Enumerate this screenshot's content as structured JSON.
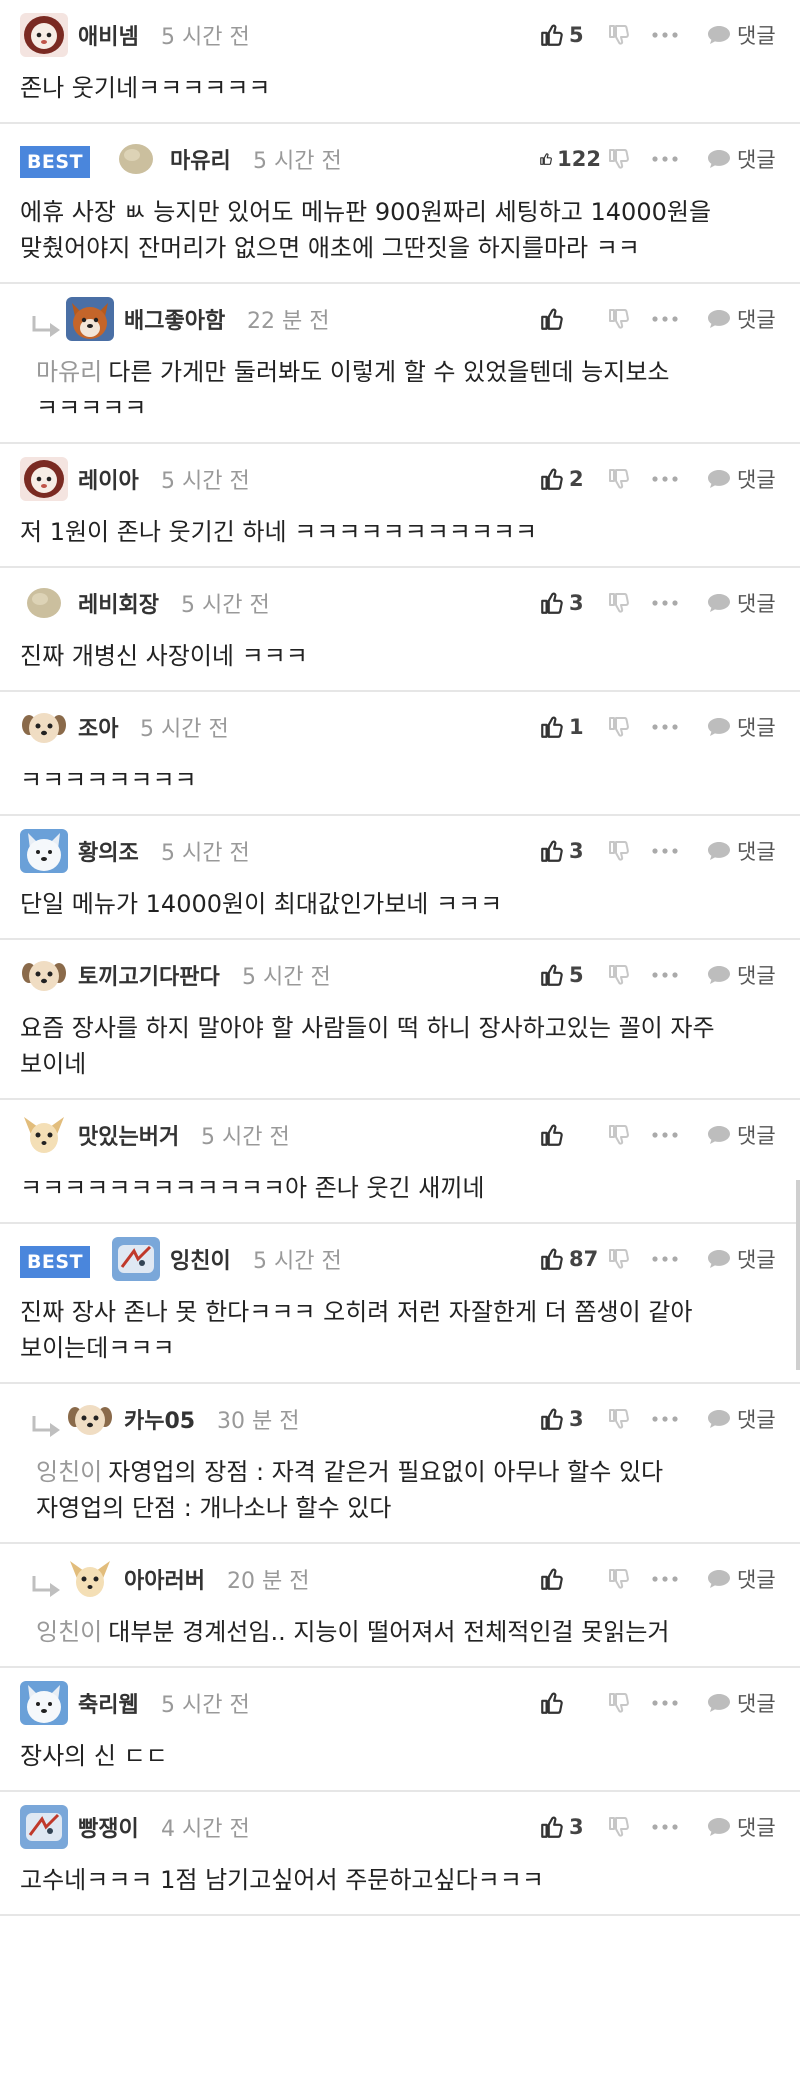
{
  "ui": {
    "reply_label": "댓글",
    "best_label": "BEST",
    "colors": {
      "best": "#4a86dc",
      "name": "#333333",
      "time": "#999999",
      "icon": "#555555"
    }
  },
  "comments": [
    {
      "name": "애비넴",
      "time": "5 시간 전",
      "likes": "5",
      "best": false,
      "reply": false,
      "avatar": "doll",
      "mention": "",
      "text": "존나 웃기네ㅋㅋㅋㅋㅋㅋ"
    },
    {
      "name": "마유리",
      "time": "5 시간 전",
      "likes": "122",
      "best": true,
      "reply": false,
      "avatar": "round",
      "mention": "",
      "text": "에휴 사장 ㅄ 능지만 있어도 메뉴판 900원짜리 세팅하고 14000원을 맞췄어야지 잔머리가 없으면 애초에 그딴짓을 하지를마라 ㅋㅋ"
    },
    {
      "name": "배그좋아함",
      "time": "22 분 전",
      "likes": "",
      "best": false,
      "reply": true,
      "avatar": "shiba",
      "mention": "마유리",
      "text": "다른 가게만 둘러봐도 이렇게 할 수 있었을텐데 능지보소 ㅋㅋㅋㅋㅋ"
    },
    {
      "name": "레이아",
      "time": "5 시간 전",
      "likes": "2",
      "best": false,
      "reply": false,
      "avatar": "doll",
      "mention": "",
      "text": "저 1원이 존나 웃기긴 하네 ㅋㅋㅋㅋㅋㅋㅋㅋㅋㅋㅋ"
    },
    {
      "name": "레비회장",
      "time": "5 시간 전",
      "likes": "3",
      "best": false,
      "reply": false,
      "avatar": "round",
      "mention": "",
      "text": "진짜 개병신 사장이네 ㅋㅋㅋ"
    },
    {
      "name": "조아",
      "time": "5 시간 전",
      "likes": "1",
      "best": false,
      "reply": false,
      "avatar": "puppy",
      "mention": "",
      "text": "ㅋㅋㅋㅋㅋㅋㅋㅋ"
    },
    {
      "name": "황의조",
      "time": "5 시간 전",
      "likes": "3",
      "best": false,
      "reply": false,
      "avatar": "husky",
      "mention": "",
      "text": "단일 메뉴가 14000원이 최대값인가보네 ㅋㅋㅋ"
    },
    {
      "name": "토끼고기다판다",
      "time": "5 시간 전",
      "likes": "5",
      "best": false,
      "reply": false,
      "avatar": "puppy",
      "mention": "",
      "text": "요즘 장사를 하지 말아야 할 사람들이 떡 하니 장사하고있는 꼴이 자주 보이네"
    },
    {
      "name": "맛있는버거",
      "time": "5 시간 전",
      "likes": "",
      "best": false,
      "reply": false,
      "avatar": "chihuahua",
      "mention": "",
      "text": "ㅋㅋㅋㅋㅋㅋㅋㅋㅋㅋㅋㅋ아 존나 웃긴 새끼네"
    },
    {
      "name": "잉친이",
      "time": "5 시간 전",
      "likes": "87",
      "best": true,
      "reply": false,
      "avatar": "blue",
      "mention": "",
      "text": "진짜 장사 존나 못 한다ㅋㅋㅋ 오히려 저런 자잘한게 더 쫌생이 같아 보이는데ㅋㅋㅋ"
    },
    {
      "name": "카누05",
      "time": "30 분 전",
      "likes": "3",
      "best": false,
      "reply": true,
      "avatar": "puppy",
      "mention": "잉친이",
      "text": "자영업의 장점 : 자격 같은거 필요없이 아무나 할수 있다\n자영업의 단점 : 개나소나 할수 있다"
    },
    {
      "name": "아아러버",
      "time": "20 분 전",
      "likes": "",
      "best": false,
      "reply": true,
      "avatar": "chihuahua",
      "mention": "잉친이",
      "text": "대부분 경계선임.. 지능이 떨어져서 전체적인걸 못읽는거"
    },
    {
      "name": "축리웹",
      "time": "5 시간 전",
      "likes": "",
      "best": false,
      "reply": false,
      "avatar": "husky",
      "mention": "",
      "text": "장사의 신 ㄷㄷ"
    },
    {
      "name": "빵쟁이",
      "time": "4 시간 전",
      "likes": "3",
      "best": false,
      "reply": false,
      "avatar": "blue",
      "mention": "",
      "text": "고수네ㅋㅋㅋ 1점 남기고싶어서 주문하고싶다ㅋㅋㅋ"
    }
  ]
}
